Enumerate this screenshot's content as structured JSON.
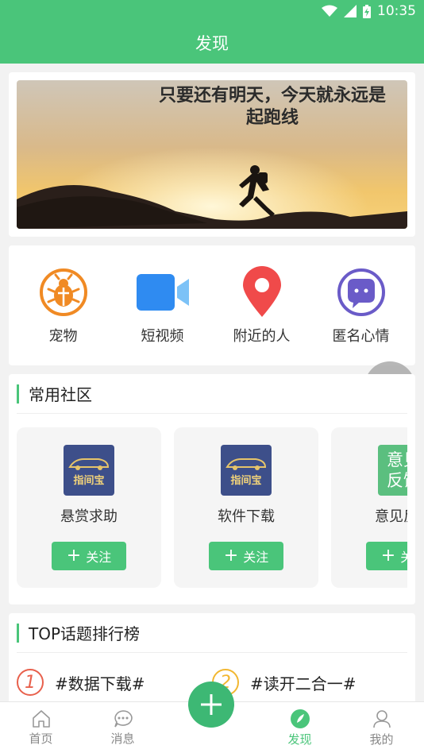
{
  "status": {
    "time": "10:35"
  },
  "header": {
    "title": "发现"
  },
  "banner": {
    "text": "只要还有明天，今天就永远是起跑线"
  },
  "categories": [
    {
      "label": "宠物",
      "icon": "bug-icon"
    },
    {
      "label": "短视频",
      "icon": "video-camera-icon"
    },
    {
      "label": "附近的人",
      "icon": "location-pin-icon"
    },
    {
      "label": "匿名心情",
      "icon": "chat-bubble-icon"
    }
  ],
  "communities": {
    "title": "常用社区",
    "items": [
      {
        "name": "悬赏求助",
        "logo": "指间宝",
        "follow": "关注"
      },
      {
        "name": "软件下载",
        "logo": "指间宝",
        "follow": "关注"
      },
      {
        "name": "意见反馈",
        "logo": "意见反馈",
        "follow": "关注"
      }
    ]
  },
  "topics": {
    "title": "TOP话题排行榜",
    "items": [
      {
        "rank": "1",
        "text": "#数据下载#",
        "color": "#e8604c"
      },
      {
        "rank": "2",
        "text": "#读开二合一#",
        "color": "#f2b731"
      }
    ]
  },
  "tabs": [
    {
      "label": "首页",
      "icon": "home-icon"
    },
    {
      "label": "消息",
      "icon": "message-icon"
    },
    {
      "label": "发现",
      "icon": "discover-icon",
      "active": true
    },
    {
      "label": "我的",
      "icon": "user-icon"
    }
  ],
  "colors": {
    "accent": "#4ac57a"
  }
}
